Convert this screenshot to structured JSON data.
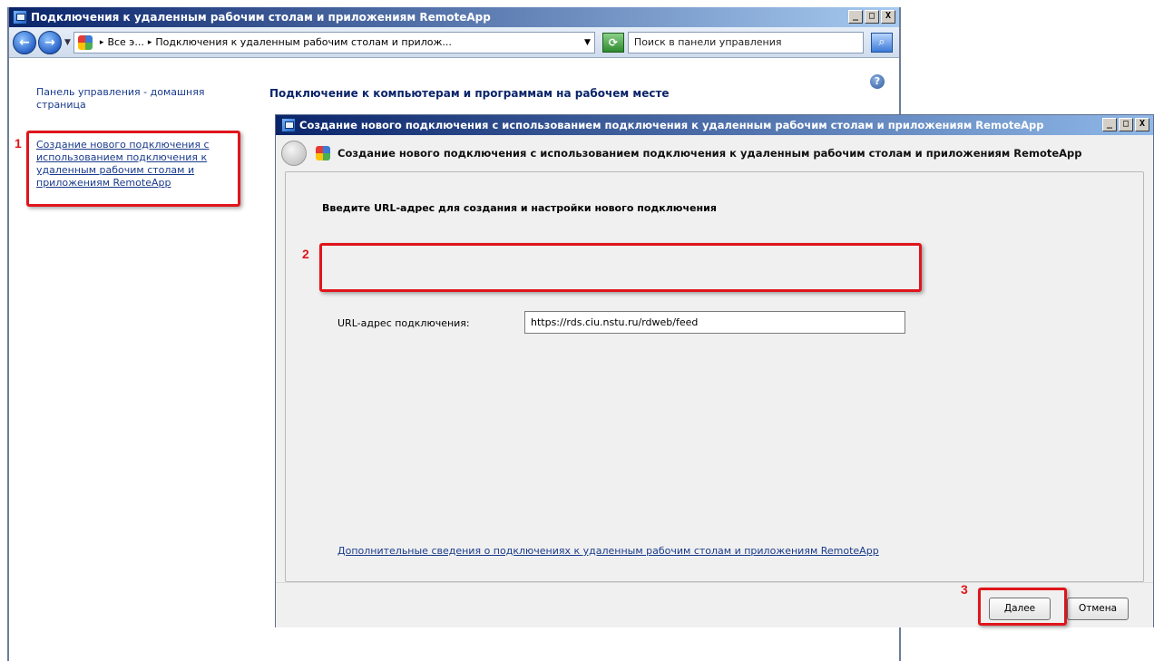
{
  "main_window": {
    "title": "Подключения к удаленным рабочим столам и приложениям RemoteApp",
    "controls": {
      "minimize": "_",
      "maximize": "□",
      "close": "X"
    },
    "address": {
      "crumb_root": "Все э...",
      "crumb_current": "Подключения к удаленным рабочим столам и прилож...",
      "search_placeholder": "Поиск в панели управления"
    },
    "sidebar": {
      "home_link": "Панель управления - домашняя страница",
      "create_link": "Создание нового подключения с использованием подключения к удаленным рабочим столам и приложениям RemoteApp"
    },
    "content_heading": "Подключение к компьютерам и программам на рабочем месте"
  },
  "dialog": {
    "title": "Создание нового подключения с использованием подключения к удаленным рабочим столам и приложениям RemoteApp",
    "header": "Создание нового подключения с использованием подключения к удаленным рабочим столам и приложениям RemoteApp",
    "instruction": "Введите URL-адрес для создания и настройки нового подключения",
    "url_label": "URL-адрес подключения:",
    "url_value": "https://rds.ciu.nstu.ru/rdweb/feed",
    "more_info_link": "Дополнительные сведения о подключениях к удаленным рабочим столам и приложениям RemoteApp",
    "next_button": "Далее",
    "cancel_button": "Отмена"
  },
  "annotations": {
    "step1": "1",
    "step2": "2",
    "step3": "3",
    "highlight_color": "#e0151b"
  },
  "icons": {
    "back": "back-arrow-icon",
    "forward": "forward-arrow-icon",
    "refresh": "refresh-icon",
    "search": "search-icon",
    "help": "help-icon"
  }
}
